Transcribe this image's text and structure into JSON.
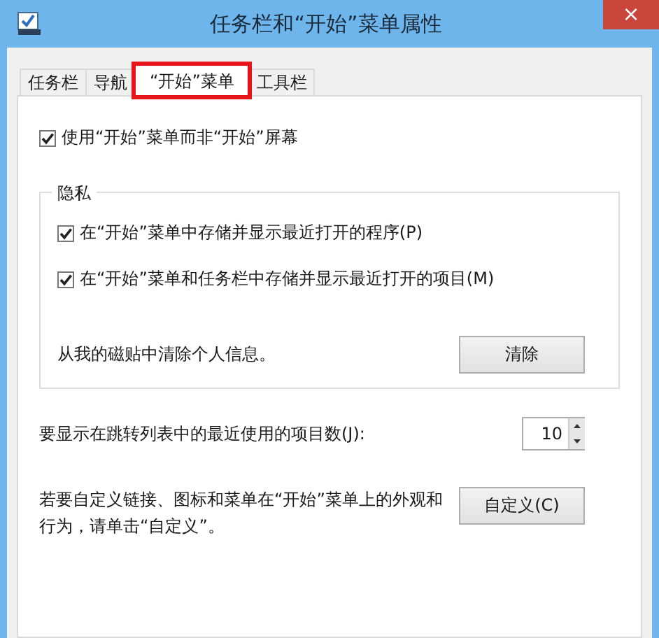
{
  "window": {
    "title": "任务栏和“开始”菜单属性",
    "close": "×"
  },
  "tabs": [
    {
      "label": "任务栏",
      "selected": false,
      "highlighted": false
    },
    {
      "label": "导航",
      "selected": false,
      "highlighted": false
    },
    {
      "label": "“开始”菜单",
      "selected": true,
      "highlighted": true
    },
    {
      "label": "工具栏",
      "selected": false,
      "highlighted": false
    }
  ],
  "use_start_menu": {
    "label": "使用“开始”菜单而非“开始”屏幕",
    "checked": true
  },
  "privacy": {
    "title": "隐私",
    "options": [
      {
        "label": "在“开始”菜单中存储并显示最近打开的程序(P)",
        "checked": true
      },
      {
        "label": "在“开始”菜单和任务栏中存储并显示最近打开的项目(M)",
        "checked": true
      }
    ],
    "clear_text": "从我的磁贴中清除个人信息。",
    "clear_button": "清除"
  },
  "jump_list": {
    "label": "要显示在跳转列表中的最近使用的项目数(J):",
    "value": "10"
  },
  "customize": {
    "text": "若要自定义链接、图标和菜单在“开始”菜单上的外观和行为，请单击“自定义”。",
    "button": "自定义(C)"
  }
}
